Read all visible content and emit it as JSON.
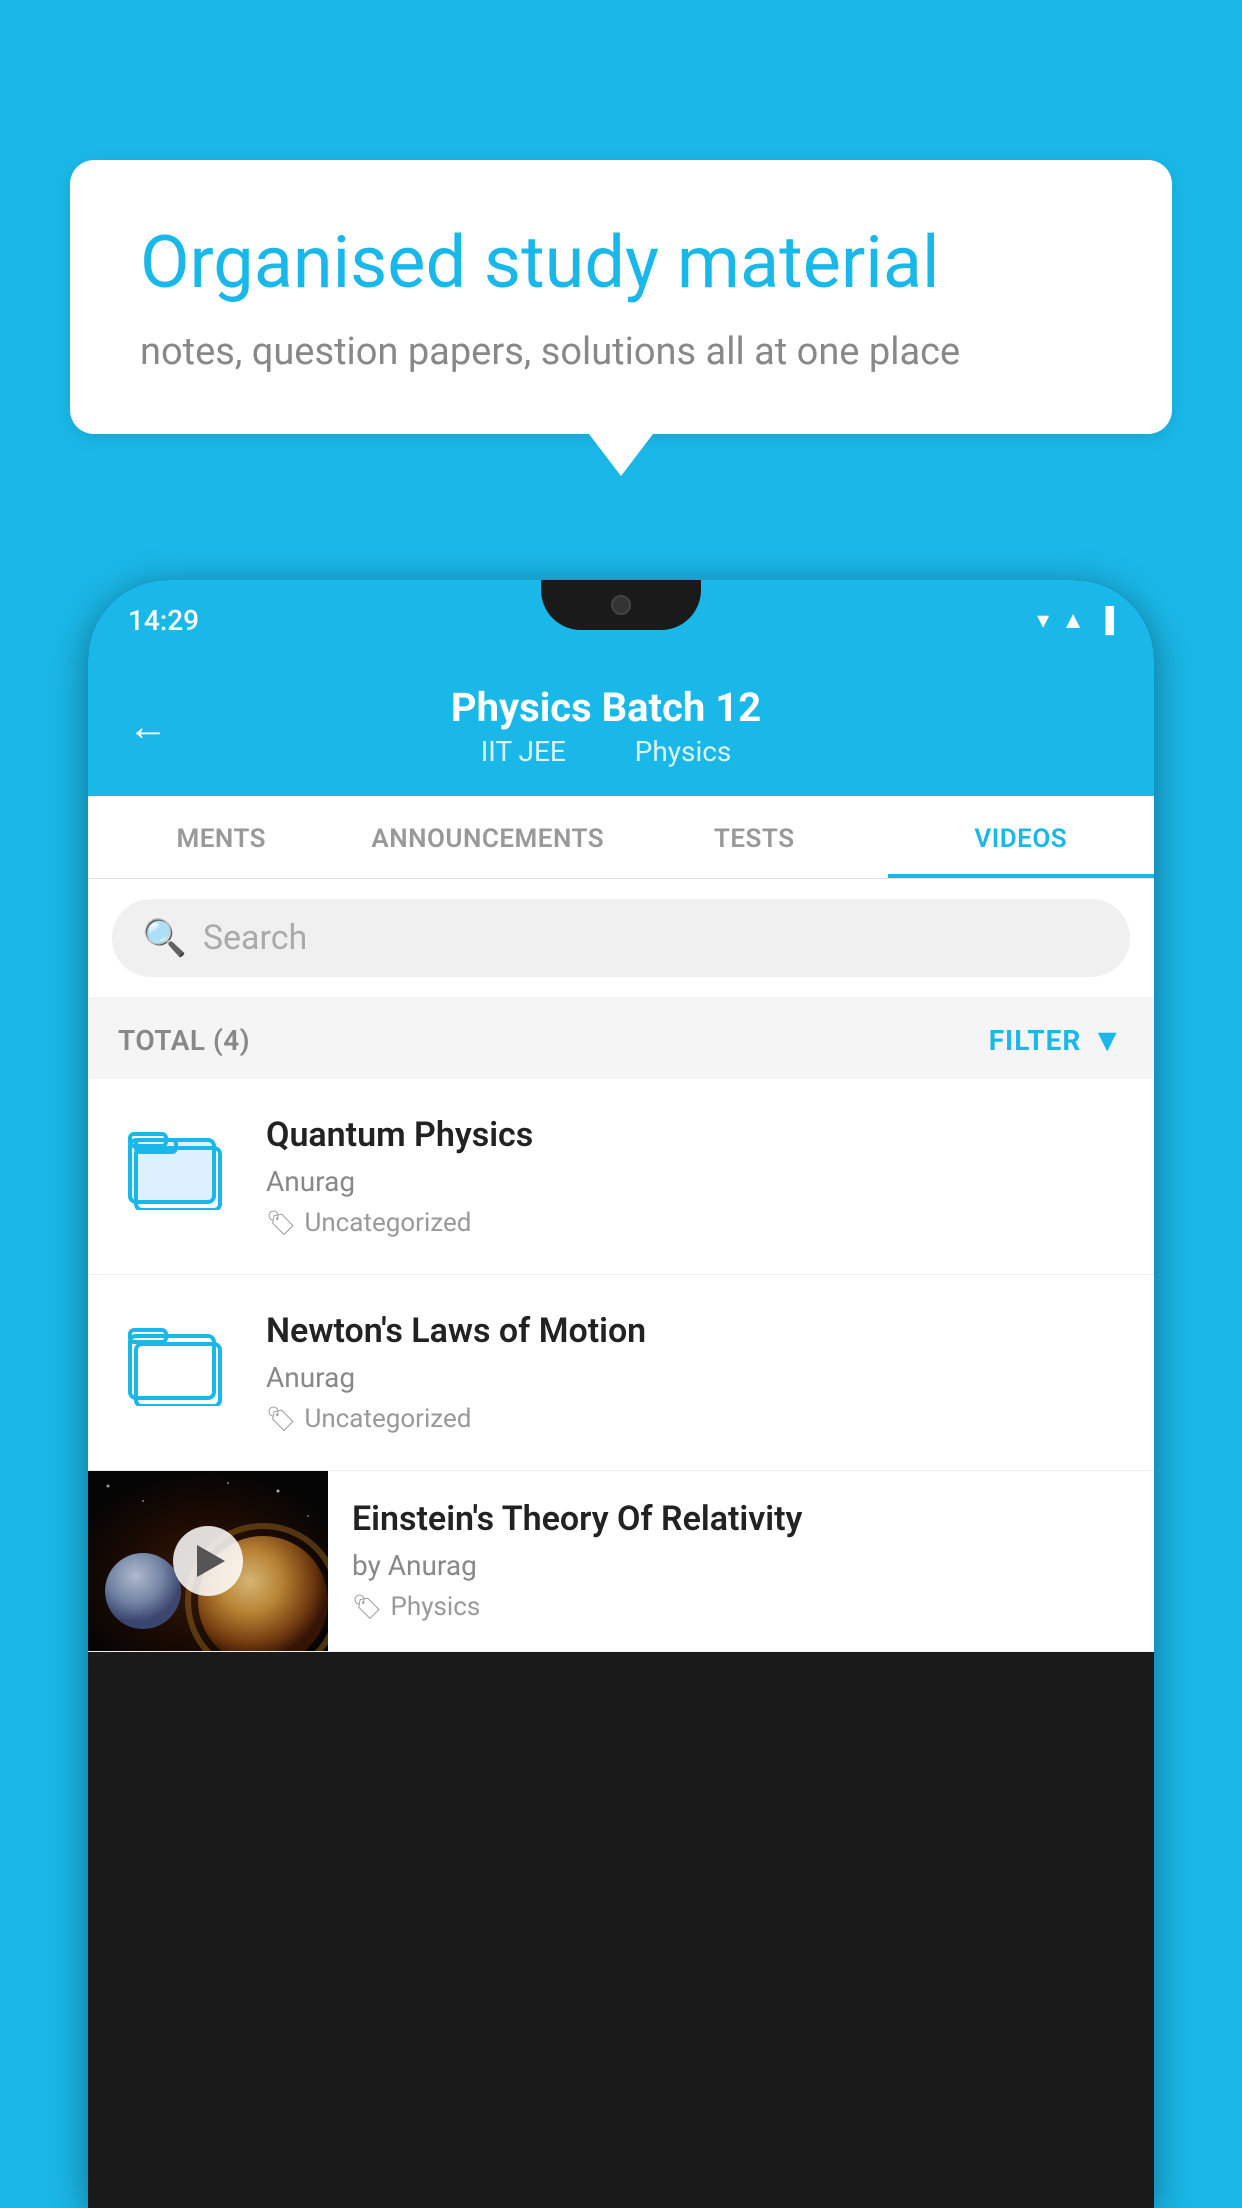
{
  "background_color": "#1ab8e8",
  "bubble": {
    "title": "Organised study material",
    "subtitle": "notes, question papers, solutions all at one place"
  },
  "phone": {
    "status_bar": {
      "time": "14:29"
    },
    "header": {
      "title": "Physics Batch 12",
      "subtitle_left": "IIT JEE",
      "subtitle_right": "Physics",
      "back_label": "←"
    },
    "tabs": [
      {
        "label": "MENTS",
        "active": false
      },
      {
        "label": "ANNOUNCEMENTS",
        "active": false
      },
      {
        "label": "TESTS",
        "active": false
      },
      {
        "label": "VIDEOS",
        "active": true
      }
    ],
    "search": {
      "placeholder": "Search"
    },
    "filter": {
      "total_label": "TOTAL (4)",
      "filter_label": "FILTER"
    },
    "videos": [
      {
        "id": "quantum",
        "title": "Quantum Physics",
        "author": "Anurag",
        "tag": "Uncategorized",
        "type": "folder"
      },
      {
        "id": "newton",
        "title": "Newton's Laws of Motion",
        "author": "Anurag",
        "tag": "Uncategorized",
        "type": "folder"
      },
      {
        "id": "einstein",
        "title": "Einstein's Theory Of Relativity",
        "author": "by Anurag",
        "tag": "Physics",
        "type": "video"
      }
    ]
  }
}
